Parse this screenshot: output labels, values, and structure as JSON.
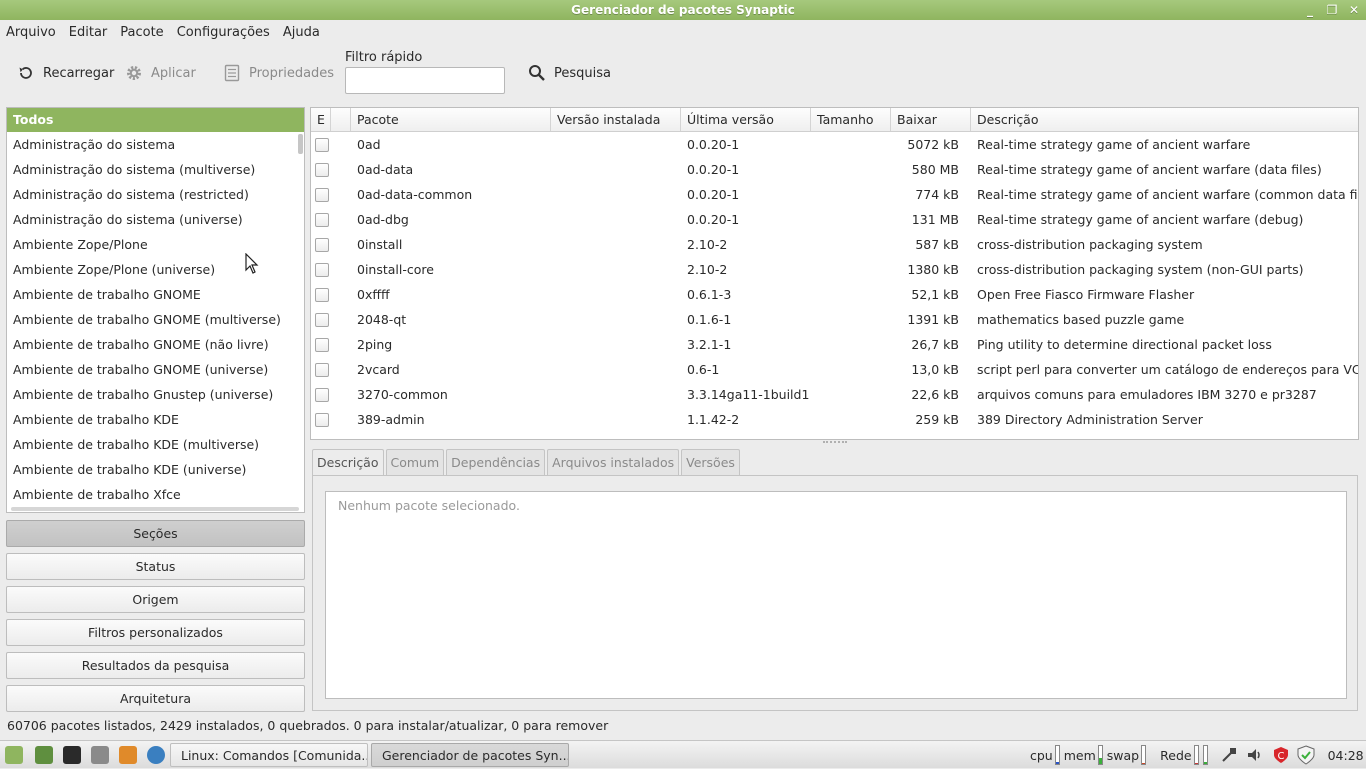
{
  "window": {
    "title": "Gerenciador de pacotes Synaptic",
    "minimize": "_",
    "maximize": "❐",
    "close": "✕"
  },
  "menubar": [
    "Arquivo",
    "Editar",
    "Pacote",
    "Configurações",
    "Ajuda"
  ],
  "toolbar": {
    "reload": "Recarregar",
    "apply": "Aplicar",
    "properties": "Propriedades",
    "quick_filter_label": "Filtro rápido",
    "quick_filter_value": "",
    "search": "Pesquisa"
  },
  "sections": {
    "header": "Todos",
    "items": [
      "Administração do sistema",
      "Administração do sistema (multiverse)",
      "Administração do sistema (restricted)",
      "Administração do sistema (universe)",
      "Ambiente Zope/Plone",
      "Ambiente Zope/Plone (universe)",
      "Ambiente de trabalho GNOME",
      "Ambiente de trabalho GNOME (multiverse)",
      "Ambiente de trabalho GNOME (não livre)",
      "Ambiente de trabalho GNOME (universe)",
      "Ambiente de trabalho Gnustep (universe)",
      "Ambiente de trabalho KDE",
      "Ambiente de trabalho KDE (multiverse)",
      "Ambiente de trabalho KDE (universe)",
      "Ambiente de trabalho Xfce"
    ]
  },
  "filter_buttons": [
    "Seções",
    "Status",
    "Origem",
    "Filtros personalizados",
    "Resultados da pesquisa",
    "Arquitetura"
  ],
  "table": {
    "columns": [
      "E",
      "",
      "Pacote",
      "Versão instalada",
      "Última versão",
      "Tamanho",
      "Baixar",
      "Descrição"
    ],
    "rows": [
      {
        "name": "0ad",
        "installed": "",
        "latest": "0.0.20-1",
        "size": "",
        "download": "5072 kB",
        "desc": "Real-time strategy game of ancient warfare"
      },
      {
        "name": "0ad-data",
        "installed": "",
        "latest": "0.0.20-1",
        "size": "",
        "download": "580 MB",
        "desc": "Real-time strategy game of ancient warfare (data files)"
      },
      {
        "name": "0ad-data-common",
        "installed": "",
        "latest": "0.0.20-1",
        "size": "",
        "download": "774 kB",
        "desc": "Real-time strategy game of ancient warfare (common data files)"
      },
      {
        "name": "0ad-dbg",
        "installed": "",
        "latest": "0.0.20-1",
        "size": "",
        "download": "131 MB",
        "desc": "Real-time strategy game of ancient warfare (debug)"
      },
      {
        "name": "0install",
        "installed": "",
        "latest": "2.10-2",
        "size": "",
        "download": "587 kB",
        "desc": "cross-distribution packaging system"
      },
      {
        "name": "0install-core",
        "installed": "",
        "latest": "2.10-2",
        "size": "",
        "download": "1380 kB",
        "desc": "cross-distribution packaging system (non-GUI parts)"
      },
      {
        "name": "0xffff",
        "installed": "",
        "latest": "0.6.1-3",
        "size": "",
        "download": "52,1 kB",
        "desc": "Open Free Fiasco Firmware Flasher"
      },
      {
        "name": "2048-qt",
        "installed": "",
        "latest": "0.1.6-1",
        "size": "",
        "download": "1391 kB",
        "desc": "mathematics based puzzle game"
      },
      {
        "name": "2ping",
        "installed": "",
        "latest": "3.2.1-1",
        "size": "",
        "download": "26,7 kB",
        "desc": "Ping utility to determine directional packet loss"
      },
      {
        "name": "2vcard",
        "installed": "",
        "latest": "0.6-1",
        "size": "",
        "download": "13,0 kB",
        "desc": "script perl para converter um catálogo de endereços para VCARD"
      },
      {
        "name": "3270-common",
        "installed": "",
        "latest": "3.3.14ga11-1build1",
        "size": "",
        "download": "22,6 kB",
        "desc": "arquivos comuns para emuladores IBM 3270 e pr3287"
      },
      {
        "name": "389-admin",
        "installed": "",
        "latest": "1.1.42-2",
        "size": "",
        "download": "259 kB",
        "desc": "389 Directory Administration Server"
      }
    ]
  },
  "detail_tabs": [
    "Descrição",
    "Comum",
    "Dependências",
    "Arquivos instalados",
    "Versões"
  ],
  "detail_text": "Nenhum pacote selecionado.",
  "status": "60706 pacotes listados, 2429 instalados, 0 quebrados. 0 para instalar/atualizar, 0 para remover",
  "taskbar": {
    "tasks": [
      "Linux: Comandos [Comunida...",
      "Gerenciador de pacotes Syn..."
    ],
    "cpu": "cpu",
    "mem": "mem",
    "swap": "swap",
    "net": "Rede",
    "meters": {
      "cpu": 0.1,
      "mem": 0.35,
      "swap": 0.05,
      "net_up": 0.05,
      "net_down": 0.1
    },
    "clock": "04:28"
  },
  "colors": {
    "accent": "#8fb55f"
  }
}
